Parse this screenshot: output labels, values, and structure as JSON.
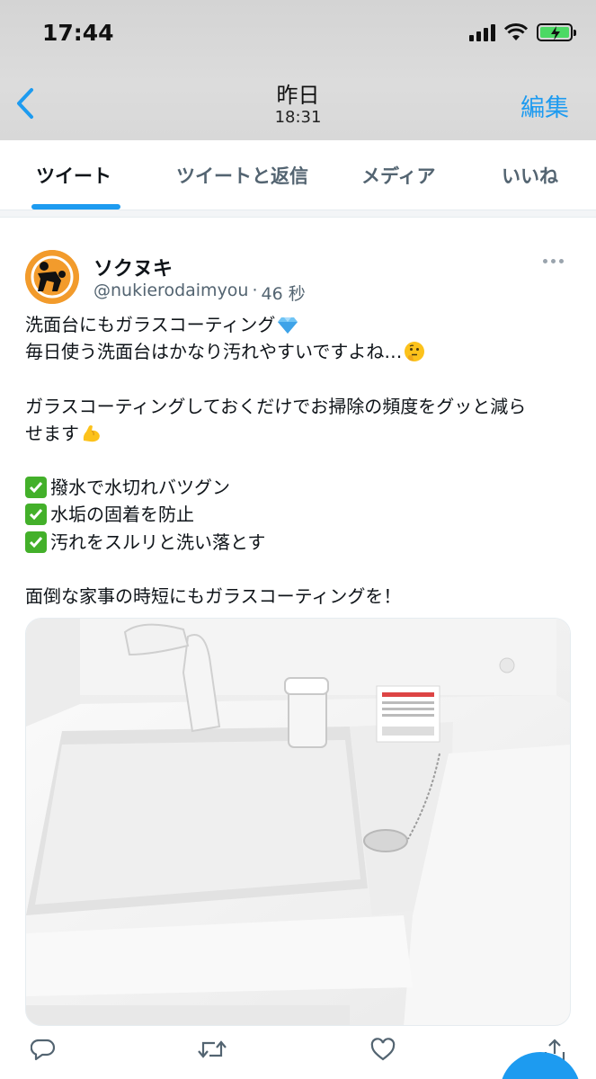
{
  "status_bar": {
    "time": "17:44"
  },
  "nav": {
    "title": "昨日",
    "subtitle": "18:31",
    "edit_label": "編集"
  },
  "tabs": [
    {
      "label": "ツイート",
      "active": true
    },
    {
      "label": "ツイートと返信",
      "active": false
    },
    {
      "label": "メディア",
      "active": false
    },
    {
      "label": "いいね",
      "active": false
    }
  ],
  "tweet": {
    "author_name": "ソクヌキ",
    "handle": "@nukierodaimyou",
    "separator": "·",
    "time_ago": "46 秒",
    "lines": {
      "l1": "洗面台にもガラスコーティング",
      "l2": "毎日使う洗面台はかなり汚れやすいですよね…",
      "l3": "ガラスコーティングしておくだけでお掃除の頻度をグッと減ら",
      "l4": "せます",
      "l5": "撥水で水切れバツグン",
      "l6": "水垢の固着を防止",
      "l7": "汚れをスルリと洗い落とす",
      "l8": "面倒な家事の時短にもガラスコーティングを！"
    },
    "emojis": {
      "l1": "gem-emoji",
      "l2": "thinking-face-emoji",
      "l4": "flexed-biceps-emoji",
      "checks": "check-mark-button-emoji"
    }
  },
  "colors": {
    "accent": "#1d9bf0",
    "avatar_bg": "#f29b2c",
    "check_green": "#43b02a",
    "secondary_text": "#536471"
  },
  "icons": {
    "back": "chevron-left-icon",
    "reply": "reply-icon",
    "retweet": "retweet-icon",
    "like": "heart-icon",
    "share": "share-icon"
  }
}
